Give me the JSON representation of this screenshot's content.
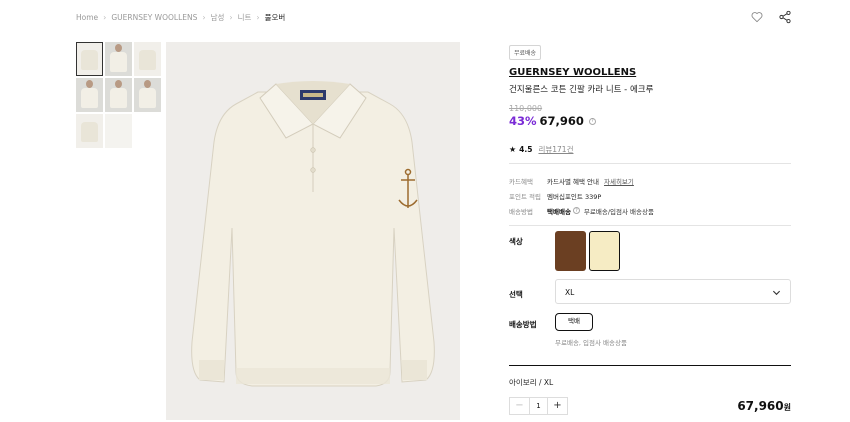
{
  "breadcrumb": [
    "Home",
    "GUERNSEY WOOLLENS",
    "남성",
    "니트",
    "풀오버"
  ],
  "actions": {
    "wishlist_icon": "heart-icon",
    "share_icon": "share-icon"
  },
  "gallery": {
    "thumbnail_count": 8,
    "selected_index": 0
  },
  "product": {
    "badge": "무료배송",
    "brand": "GUERNSEY WOOLLENS",
    "name": "건지울른스 코튼 긴팔 카라 니트 - 에크루",
    "original_price": "110,000",
    "discount": "43%",
    "sale_price": "67,960",
    "rating": "4.5",
    "reviews": "리뷰171건"
  },
  "benefits": {
    "card_label": "카드혜택",
    "card_value": "카드사별 혜택 안내",
    "card_link": "자세히보기",
    "point_label": "포인트 적립",
    "point_value": "멤버십포인트 339P",
    "delivery_label": "배송방법",
    "delivery_method": "택배배송",
    "delivery_value": "무료배송/입점사 배송상품"
  },
  "options": {
    "color_label": "색상",
    "colors": [
      {
        "name": "brown",
        "hex": "#6b3f22"
      },
      {
        "name": "ivory",
        "hex": "#f6ecc4"
      }
    ],
    "select_label": "선택",
    "selected_size": "XL",
    "shipping_label": "배송방법",
    "shipping_chip": "택배",
    "shipping_note": "무료배송, 입점사 배송상품"
  },
  "summary": {
    "selected_option": "아이보리 / XL",
    "quantity": "1",
    "minus": "−",
    "plus": "+",
    "total": "67,960",
    "currency": "원"
  }
}
